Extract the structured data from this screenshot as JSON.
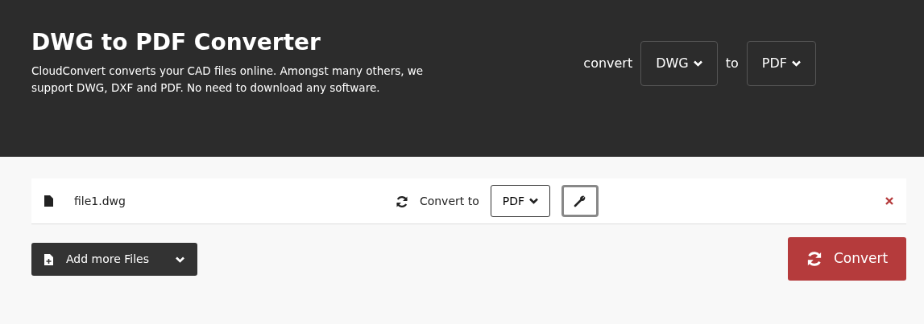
{
  "header": {
    "title": "DWG to PDF Converter",
    "description": "CloudConvert converts your CAD files online. Amongst many others, we support DWG, DXF and PDF. No need to download any software."
  },
  "format_picker": {
    "prefix": "convert",
    "from": "DWG",
    "joiner": "to",
    "to": "PDF"
  },
  "files": [
    {
      "name": "file1.dwg",
      "convert_label": "Convert to",
      "target": "PDF"
    }
  ],
  "actions": {
    "add_files": "Add more Files",
    "convert": "Convert"
  }
}
